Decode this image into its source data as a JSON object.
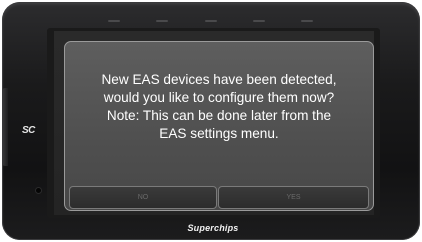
{
  "device": {
    "left_logo": "SC",
    "bottom_brand": "Superchips"
  },
  "dialog": {
    "message_lines": [
      "New EAS devices have been detected,",
      "would you like to configure them now?",
      "Note: This can be done later from the",
      "EAS settings menu."
    ],
    "no_label": "NO",
    "yes_label": "YES"
  },
  "colors": {
    "bezel": "#1a1a1b",
    "dialog_bg": "#555555",
    "dialog_border": "#9a9a9a",
    "text": "#ffffff",
    "button_text": "#6a6a6a"
  }
}
